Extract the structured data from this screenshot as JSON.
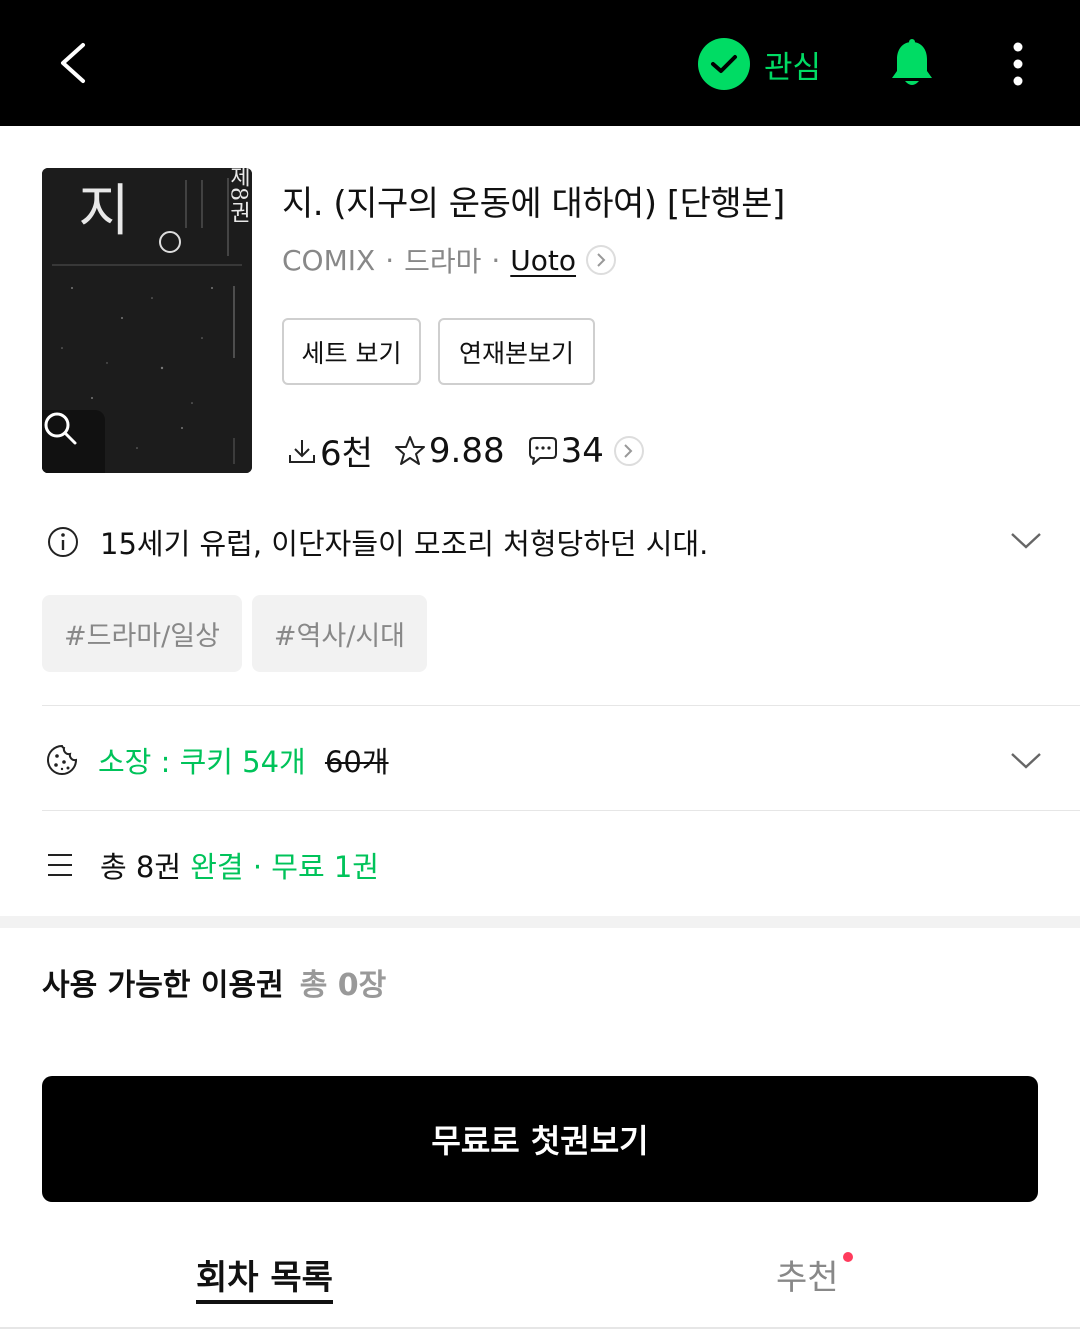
{
  "topbar": {
    "back_icon": "chevron-left-icon",
    "follow_label": "관심",
    "follow_icon": "check-circle-icon",
    "bell_icon": "bell-icon",
    "more_icon": "more-vertical-icon",
    "accent_color": "#00dc64"
  },
  "cover": {
    "title_glyph": "지",
    "volume_text": "제8권",
    "zoom_icon": "search-icon"
  },
  "book": {
    "title": "지. (지구의 운동에 대하여) [단행본]",
    "publisher": "COMIX",
    "genre": "드라마",
    "author": "Uoto"
  },
  "actions": {
    "set_view": "세트 보기",
    "serial_view": "연재본보기"
  },
  "stats": {
    "downloads": "6천",
    "rating": "9.88",
    "comments": "34"
  },
  "synopsis": {
    "text": "15세기 유럽, 이단자들이 모조리 처형당하던 시대."
  },
  "tags": [
    "#드라마/일상",
    "#역사/시대"
  ],
  "ownership": {
    "label": "소장 : 쿠키 54개",
    "original_price": "60개"
  },
  "volumes": {
    "total": "총 8권",
    "status": "완결",
    "free": "무료 1권"
  },
  "tickets": {
    "title": "사용 가능한 이용권",
    "count": "총 0장"
  },
  "cta": {
    "label": "무료로 첫권보기"
  },
  "tabs": {
    "episodes": "회차 목록",
    "recommend": "추천"
  }
}
